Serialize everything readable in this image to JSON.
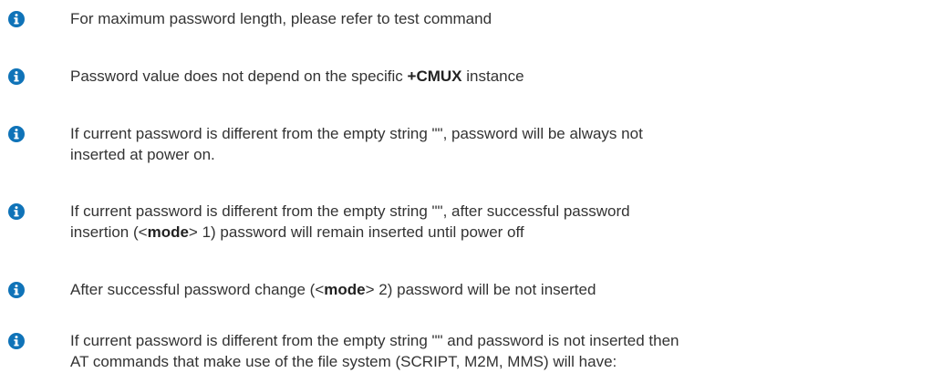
{
  "notes": [
    {
      "icon": "info-icon",
      "text": "For maximum password length, please refer to test command"
    },
    {
      "icon": "info-icon",
      "before": "Password value does not depend on the specific ",
      "bold": "+CMUX",
      "after": " instance"
    },
    {
      "icon": "info-icon",
      "line1": "If current password is different from the empty string \"\", password will be always not",
      "line2": "inserted at power on."
    },
    {
      "icon": "info-icon",
      "line1": "If current password is different from the empty string \"\", after successful password",
      "line2_before": "insertion (<",
      "line2_bold": "mode",
      "line2_after": "> 1) password will remain inserted until power off"
    },
    {
      "icon": "info-icon",
      "before": "After successful password change (<",
      "bold": "mode",
      "after": "> 2) password will be not inserted"
    },
    {
      "icon": "info-icon",
      "line1": "If current password is different from the empty string \"\" and password is not inserted then",
      "line2": "AT commands that make use of the file system (SCRIPT, M2M, MMS) will have:"
    }
  ],
  "colors": {
    "icon_fill": "#0f73b8",
    "text": "#333333"
  }
}
